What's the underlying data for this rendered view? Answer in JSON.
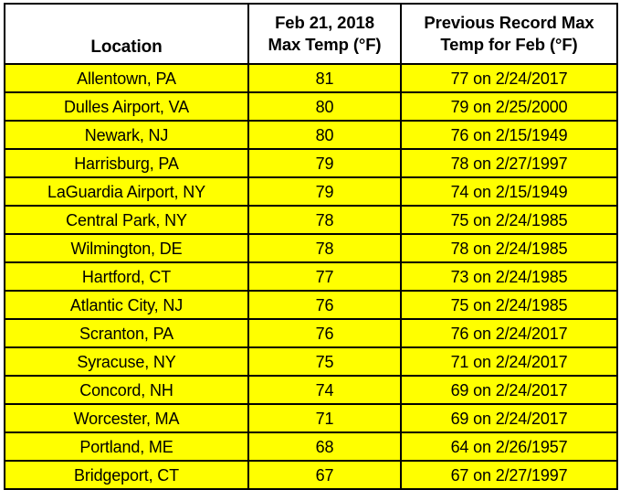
{
  "table": {
    "headers": {
      "location": "Location",
      "current": {
        "line1": "Feb 21, 2018",
        "line2": "Max Temp (°F)"
      },
      "previous": {
        "line1": "Previous Record Max",
        "line2": "Temp for Feb (°F)"
      }
    },
    "colors": {
      "row_background": "#FFFF00",
      "header_background": "#FFFFFF",
      "border": "#000000",
      "text": "#000000"
    },
    "rows": [
      {
        "location": "Allentown, PA",
        "max_temp": "81",
        "previous_record": "77 on 2/24/2017"
      },
      {
        "location": "Dulles Airport, VA",
        "max_temp": "80",
        "previous_record": "79 on 2/25/2000"
      },
      {
        "location": "Newark, NJ",
        "max_temp": "80",
        "previous_record": "76 on 2/15/1949"
      },
      {
        "location": "Harrisburg, PA",
        "max_temp": "79",
        "previous_record": "78 on 2/27/1997"
      },
      {
        "location": "LaGuardia Airport, NY",
        "max_temp": "79",
        "previous_record": "74 on 2/15/1949"
      },
      {
        "location": "Central Park, NY",
        "max_temp": "78",
        "previous_record": "75 on 2/24/1985"
      },
      {
        "location": "Wilmington, DE",
        "max_temp": "78",
        "previous_record": "78 on 2/24/1985"
      },
      {
        "location": "Hartford, CT",
        "max_temp": "77",
        "previous_record": "73 on 2/24/1985"
      },
      {
        "location": "Atlantic City, NJ",
        "max_temp": "76",
        "previous_record": "75 on 2/24/1985"
      },
      {
        "location": "Scranton, PA",
        "max_temp": "76",
        "previous_record": "76 on 2/24/2017"
      },
      {
        "location": "Syracuse, NY",
        "max_temp": "75",
        "previous_record": "71 on 2/24/2017"
      },
      {
        "location": "Concord, NH",
        "max_temp": "74",
        "previous_record": "69 on 2/24/2017"
      },
      {
        "location": "Worcester, MA",
        "max_temp": "71",
        "previous_record": "69 on 2/24/2017"
      },
      {
        "location": "Portland, ME",
        "max_temp": "68",
        "previous_record": "64 on 2/26/1957"
      },
      {
        "location": "Bridgeport, CT",
        "max_temp": "67",
        "previous_record": "67 on 2/27/1997"
      }
    ]
  }
}
